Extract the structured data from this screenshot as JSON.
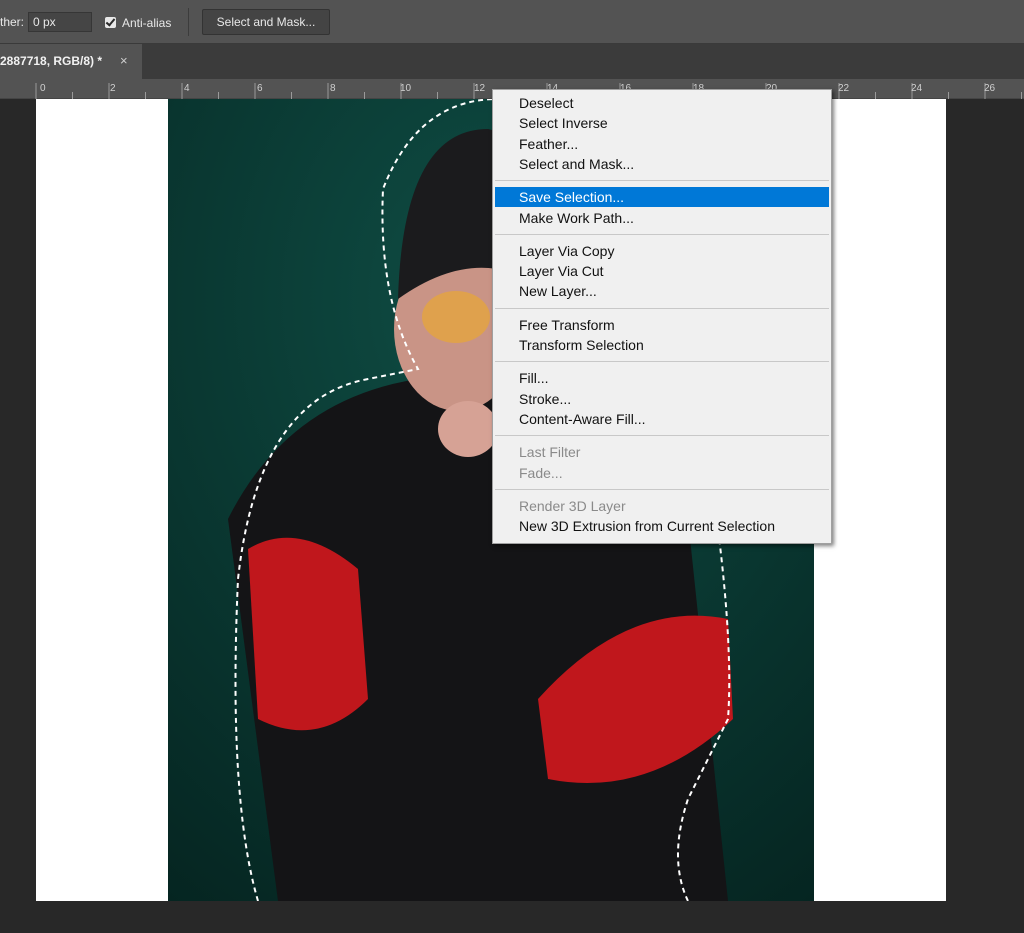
{
  "options_bar": {
    "feather_label": "ther:",
    "feather_value": "0 px",
    "anti_alias_label": "Anti-alias",
    "anti_alias_checked": true,
    "select_and_mask_label": "Select and Mask..."
  },
  "document_tab": {
    "title": "2887718, RGB/8) *",
    "close_glyph": "×"
  },
  "ruler": {
    "labels": [
      "0",
      "2",
      "4",
      "6",
      "8",
      "10",
      "12",
      "14",
      "16",
      "18",
      "20",
      "22",
      "24",
      "26"
    ]
  },
  "context_menu": {
    "groups": [
      [
        {
          "label": "Deselect",
          "state": "normal"
        },
        {
          "label": "Select Inverse",
          "state": "normal"
        },
        {
          "label": "Feather...",
          "state": "normal"
        },
        {
          "label": "Select and Mask...",
          "state": "normal"
        }
      ],
      [
        {
          "label": "Save Selection...",
          "state": "highlighted"
        },
        {
          "label": "Make Work Path...",
          "state": "normal"
        }
      ],
      [
        {
          "label": "Layer Via Copy",
          "state": "normal"
        },
        {
          "label": "Layer Via Cut",
          "state": "normal"
        },
        {
          "label": "New Layer...",
          "state": "normal"
        }
      ],
      [
        {
          "label": "Free Transform",
          "state": "normal"
        },
        {
          "label": "Transform Selection",
          "state": "normal"
        }
      ],
      [
        {
          "label": "Fill...",
          "state": "normal"
        },
        {
          "label": "Stroke...",
          "state": "normal"
        },
        {
          "label": "Content-Aware Fill...",
          "state": "normal"
        }
      ],
      [
        {
          "label": "Last Filter",
          "state": "disabled"
        },
        {
          "label": "Fade...",
          "state": "disabled"
        }
      ],
      [
        {
          "label": "Render 3D Layer",
          "state": "disabled"
        },
        {
          "label": "New 3D Extrusion from Current Selection",
          "state": "normal"
        }
      ]
    ]
  },
  "colors": {
    "highlight": "#0078d7",
    "photo_background": "#0a3d36",
    "sweater": "#141416",
    "fur_sleeve": "#c0171c",
    "selection_ants": "#ffffff"
  }
}
